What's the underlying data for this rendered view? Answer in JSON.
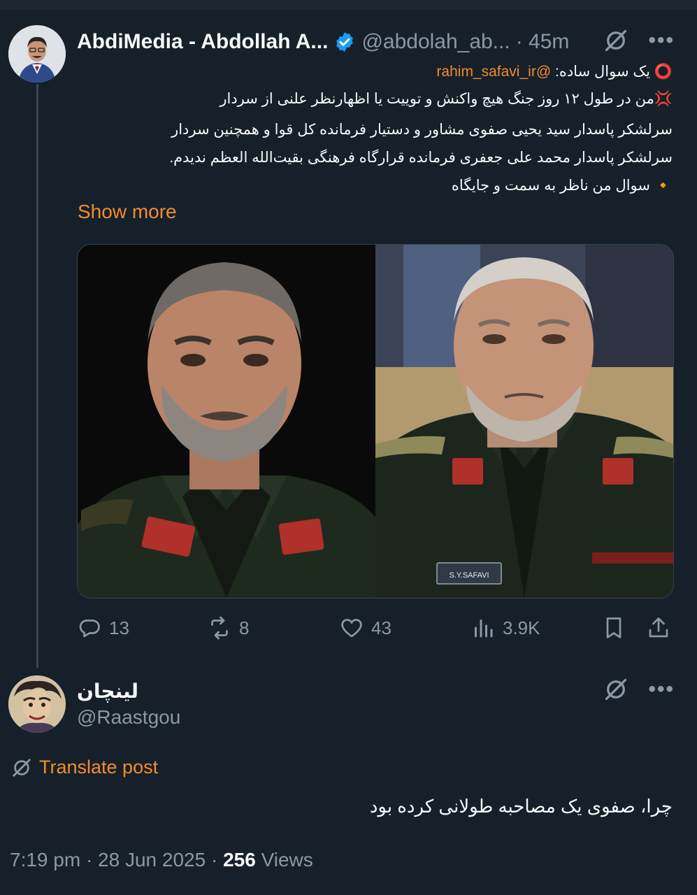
{
  "tweet": {
    "author_name": "AbdiMedia - Abdollah A...",
    "handle": "@abdolah_ab...",
    "time": "· 45m",
    "more": "•••",
    "line1_prefix": "⭕ یک سوال ساده:",
    "line1_mention": "@rahim_safavi_ir",
    "line2": "💢من در طول ۱۲ روز جنگ هیچ واکنش و توییت یا اظهارنظر علنی از سردار",
    "line3": "سرلشکر پاسدار سید یحیی صفوی مشاور و دستیار فرمانده کل قوا و همچنین سردار",
    "line4": "سرلشکر پاسدار محمد علی جعفری فرمانده قرارگاه فرهنگی بقیت‌الله العظم ندیدم.",
    "line5": "🔸 سوال من ناظر به سمت و جایگاه",
    "show_more": "Show more",
    "image_caption_nameplate": "S.Y.SAFAVI",
    "actions": {
      "replies": "13",
      "reposts": "8",
      "likes": "43",
      "views": "3.9K"
    }
  },
  "reply": {
    "author_name": "لینچان",
    "handle": "@Raastgou",
    "more": "•••",
    "translate": "Translate post",
    "text": "چرا، صفوی یک مصاحبه طولانی کرده بود",
    "time": "7:19 pm · 28 Jun 2025 ·",
    "views_count": "256",
    "views_label": "Views"
  },
  "colors": {
    "background": "#15202b",
    "accent": "#f58b2a",
    "muted": "#8b98a5",
    "verified": "#1d9bf0"
  }
}
